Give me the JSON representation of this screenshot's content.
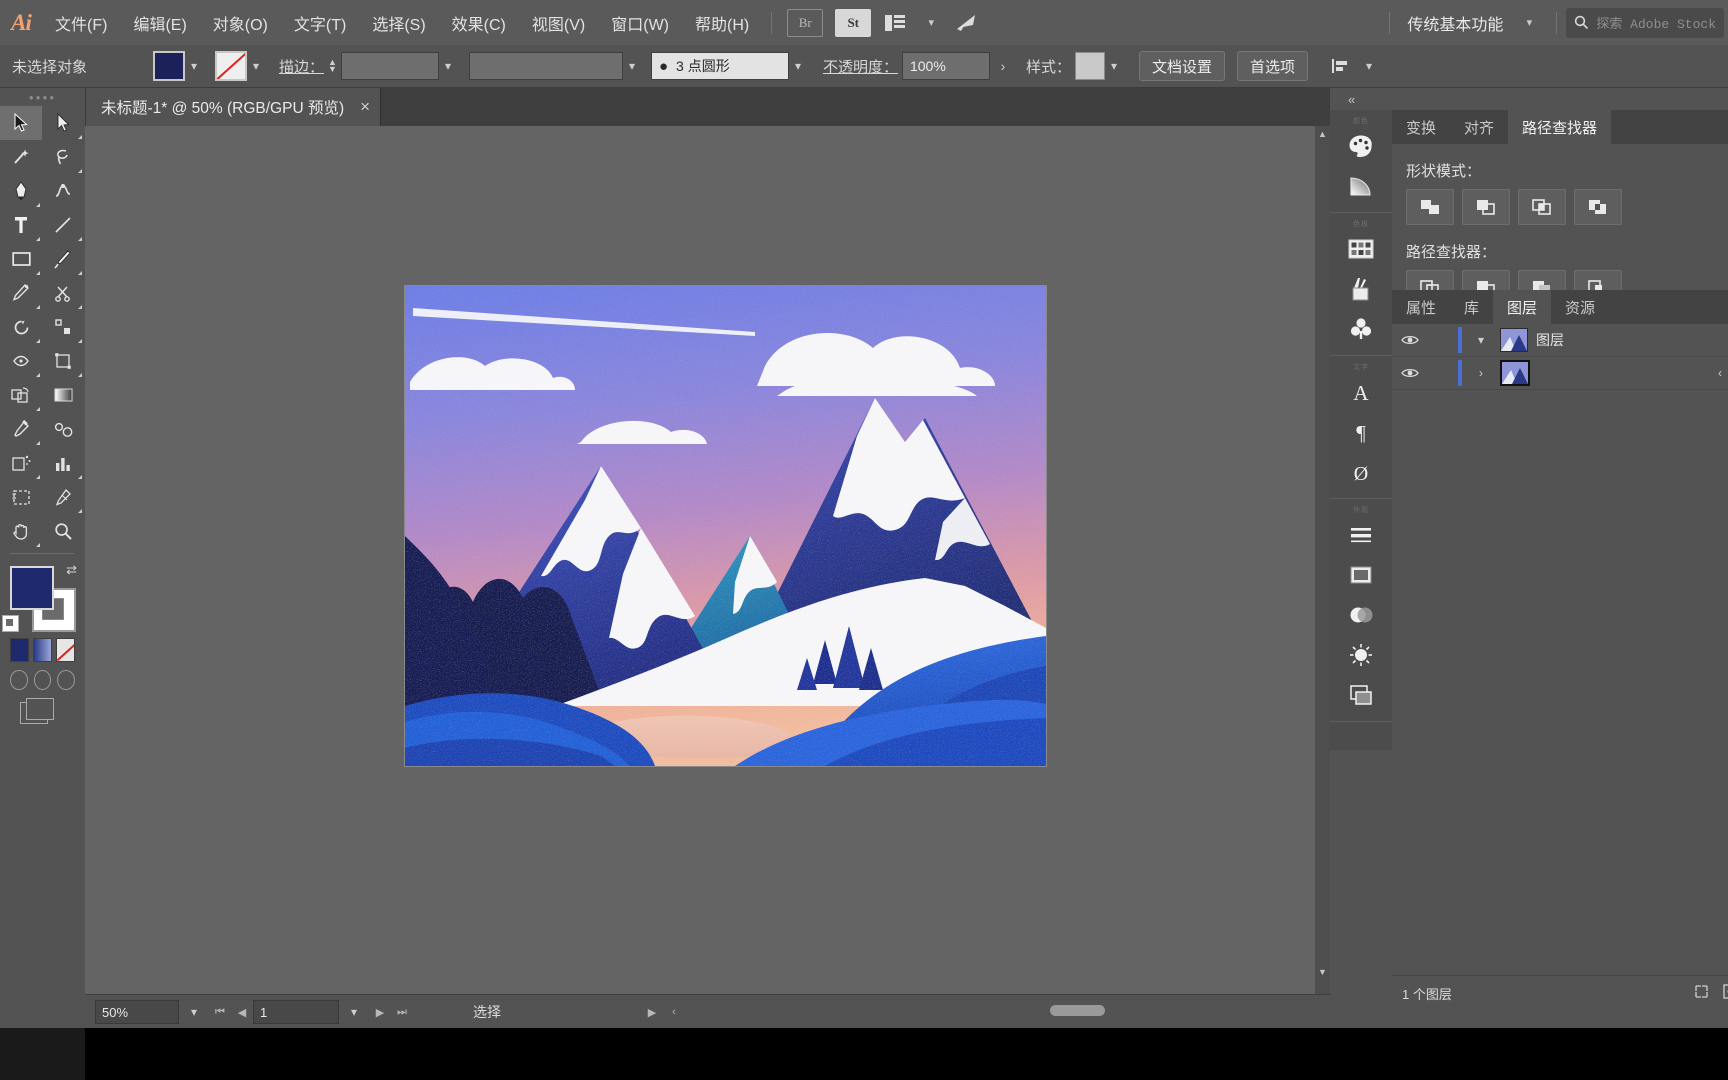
{
  "app": {
    "logo": "Ai",
    "menus": [
      {
        "label": "文件(F)"
      },
      {
        "label": "编辑(E)"
      },
      {
        "label": "对象(O)"
      },
      {
        "label": "文字(T)"
      },
      {
        "label": "选择(S)"
      },
      {
        "label": "效果(C)"
      },
      {
        "label": "视图(V)"
      },
      {
        "label": "窗口(W)"
      },
      {
        "label": "帮助(H)"
      }
    ],
    "bridge_icon": "Br",
    "stock_icon": "St",
    "arrange_icon": "arrange-documents-icon",
    "discover_icon": "discover-rocket-icon",
    "workspace": "传统基本功能",
    "search_placeholder": "探索 Adobe Stock"
  },
  "control_bar": {
    "selection_status": "未选择对象",
    "fill_color": "#1f2a6e",
    "stroke_none": true,
    "stroke_label": "描边：",
    "stroke_weight": "",
    "stroke_profile": "",
    "brush_definition": "3 点圆形",
    "opacity_label": "不透明度：",
    "opacity_value": "100%",
    "style_label": "样式：",
    "style_swatch": "#c9c9c9",
    "doc_setup_button": "文档设置",
    "preferences_button": "首选项",
    "align_icon": "align-icon"
  },
  "document": {
    "tab_title": "未标题-1* @ 50% (RGB/GPU 预览)",
    "close_icon": "close-icon"
  },
  "toolbar": {
    "grip": "tool-panel-grip",
    "tools": [
      {
        "name": "selection-tool",
        "selected": true
      },
      {
        "name": "direct-selection-tool",
        "selected": false
      },
      {
        "name": "magic-wand-tool",
        "selected": false
      },
      {
        "name": "lasso-tool",
        "selected": false
      },
      {
        "name": "pen-tool",
        "selected": false
      },
      {
        "name": "curvature-tool",
        "selected": false
      },
      {
        "name": "type-tool",
        "selected": false
      },
      {
        "name": "line-segment-tool",
        "selected": false
      },
      {
        "name": "rectangle-tool",
        "selected": false
      },
      {
        "name": "paintbrush-tool",
        "selected": false
      },
      {
        "name": "shaper-tool",
        "selected": false
      },
      {
        "name": "scissors-tool",
        "selected": false
      },
      {
        "name": "rotate-tool",
        "selected": false
      },
      {
        "name": "scale-tool",
        "selected": false
      },
      {
        "name": "width-tool",
        "selected": false
      },
      {
        "name": "free-transform-tool",
        "selected": false
      },
      {
        "name": "shape-builder-tool",
        "selected": false
      },
      {
        "name": "gradient-tool",
        "selected": false
      },
      {
        "name": "eyedropper-tool",
        "selected": false
      },
      {
        "name": "blend-tool",
        "selected": false
      },
      {
        "name": "symbol-sprayer-tool",
        "selected": false
      },
      {
        "name": "column-graph-tool",
        "selected": false
      },
      {
        "name": "artboard-tool",
        "selected": false
      },
      {
        "name": "slice-tool",
        "selected": false
      },
      {
        "name": "hand-tool",
        "selected": false
      },
      {
        "name": "zoom-tool",
        "selected": false
      }
    ],
    "fill_swatch": "#1f2a6e",
    "stroke_swatch": "#ffffff",
    "color_modes": [
      "solid-color",
      "gradient",
      "none"
    ],
    "draw_modes": [
      "draw-normal",
      "draw-behind",
      "draw-inside"
    ],
    "screen_mode": "screen-mode-icon"
  },
  "canvas": {
    "artwork_title": "mountain-landscape-illustration",
    "zoom_percent": "50%",
    "scroll_up_icon": "scroll-up-arrow",
    "scroll_down_icon": "scroll-down-arrow"
  },
  "status_bar": {
    "zoom_value": "50%",
    "page_value": "1",
    "first_icon": "first-page-icon",
    "prev_icon": "previous-page-icon",
    "next_icon": "next-page-icon",
    "last_icon": "last-page-icon",
    "status_text": "选择",
    "play_icon": "play-icon",
    "back_icon": "back-icon",
    "right_icon": "right-icon"
  },
  "right_dock": {
    "collapse_icon": "collapse-panels-icon",
    "icon_dock": [
      {
        "name": "color-panel-icon",
        "label": "颜色"
      },
      {
        "name": "gradient-panel-icon",
        "label": ""
      },
      {
        "name": "swatches-panel-icon",
        "label": "色板"
      },
      {
        "name": "brushes-panel-icon",
        "label": ""
      },
      {
        "name": "symbols-panel-icon",
        "label": ""
      },
      {
        "name": "character-panel-icon",
        "label": "文字"
      },
      {
        "name": "paragraph-panel-icon",
        "label": ""
      },
      {
        "name": "opentype-panel-icon",
        "label": ""
      },
      {
        "name": "stroke-panel-icon",
        "label": "外观"
      },
      {
        "name": "appearance-panel-icon",
        "label": ""
      },
      {
        "name": "graphic-styles-panel-icon",
        "label": ""
      },
      {
        "name": "transparency-panel-icon",
        "label": ""
      },
      {
        "name": "artboards-panel-icon",
        "label": ""
      }
    ],
    "top_panel": {
      "tabs": [
        {
          "label": "变换",
          "active": false
        },
        {
          "label": "对齐",
          "active": false
        },
        {
          "label": "路径查找器",
          "active": true
        }
      ],
      "shape_modes_label": "形状模式：",
      "shape_modes": [
        "unite-icon",
        "minus-front-icon",
        "intersect-icon",
        "exclude-icon"
      ],
      "pathfinders_label": "路径查找器：",
      "pathfinders": [
        "divide-icon",
        "trim-icon",
        "merge-icon",
        "crop-icon"
      ]
    },
    "layers_panel": {
      "tabs": [
        {
          "label": "属性",
          "active": false
        },
        {
          "label": "库",
          "active": false
        },
        {
          "label": "图层",
          "active": true
        },
        {
          "label": "资源",
          "active": false
        }
      ],
      "rows": [
        {
          "name": "图层",
          "expand_icon": "chevron-down-icon",
          "visible": true,
          "selected": false
        },
        {
          "name": "",
          "expand_icon": "chevron-right-icon",
          "visible": true,
          "selected": true
        }
      ],
      "footer_count": "1 个图层",
      "footer_icons": [
        "locate-object-icon",
        "make-clipping-mask-icon"
      ]
    }
  },
  "chart_data": null
}
